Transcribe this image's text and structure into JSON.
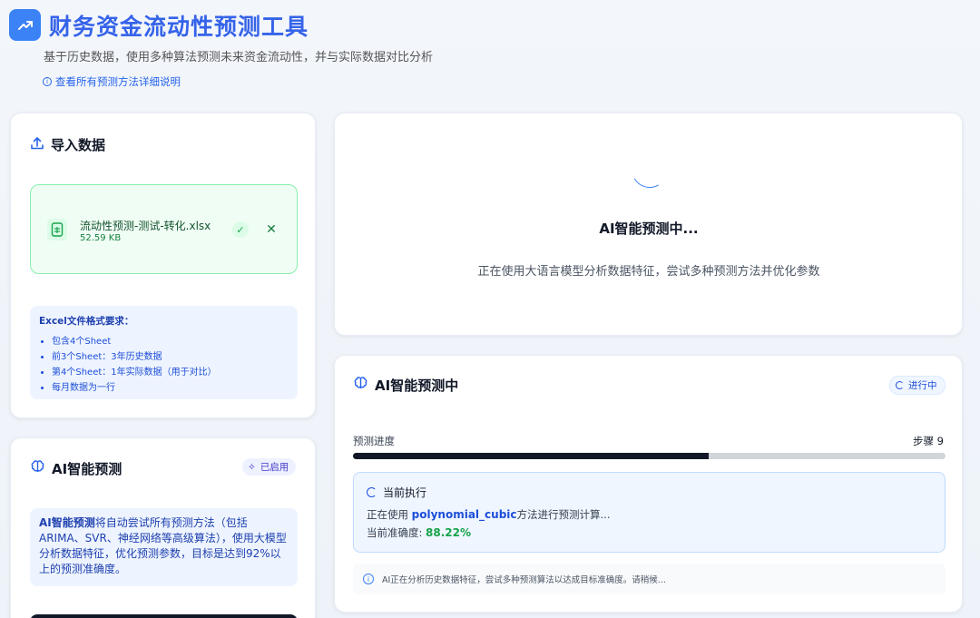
{
  "header": {
    "icon": "trending-up-icon",
    "title": "财务资金流动性预测工具",
    "subtitle": "基于历史数据，使用多种算法预测未来资金流动性，并与实际数据对比分析",
    "doc_link": "查看所有预测方法详细说明"
  },
  "import_card": {
    "title": "导入数据",
    "file": {
      "name": "流动性预测-测试-转化.xlsx",
      "size": "52.59 KB"
    },
    "requirements": {
      "title": "Excel文件格式要求：",
      "items": [
        "包含4个Sheet",
        "前3个Sheet：3年历史数据",
        "第4个Sheet：1年实际数据（用于对比）",
        "每月数据为一行"
      ]
    }
  },
  "ai_card": {
    "title": "AI智能预测",
    "badge": "已启用",
    "desc_strong": "AI智能预测",
    "desc_rest": "将自动尝试所有预测方法（包括ARIMA、SVR、神经网络等高级算法），使用大模型分析数据特征，优化预测参数，目标是达到92%以上的预测准确度。"
  },
  "status_card": {
    "title": "AI智能预测中...",
    "desc": "正在使用大语言模型分析数据特征，尝试多种预测方法并优化参数"
  },
  "progress_card": {
    "title": "AI智能预测中",
    "badge": "进行中",
    "progress_label": "预测进度",
    "step_label": "步骤 9",
    "progress_fraction": 0.6,
    "exec_title": "当前执行",
    "exec_prefix": "正在使用 ",
    "exec_method": "polynomial_cubic",
    "exec_suffix": "方法进行预测计算...",
    "accuracy_label": "当前准确度: ",
    "accuracy_value": "88.22%",
    "note": "AI正在分析历史数据特征，尝试多种预测算法以达成目标准确度。请稍候..."
  },
  "colors": {
    "brand": "#3b82f6",
    "success": "#16a34a",
    "progress_fill": "#111827"
  }
}
